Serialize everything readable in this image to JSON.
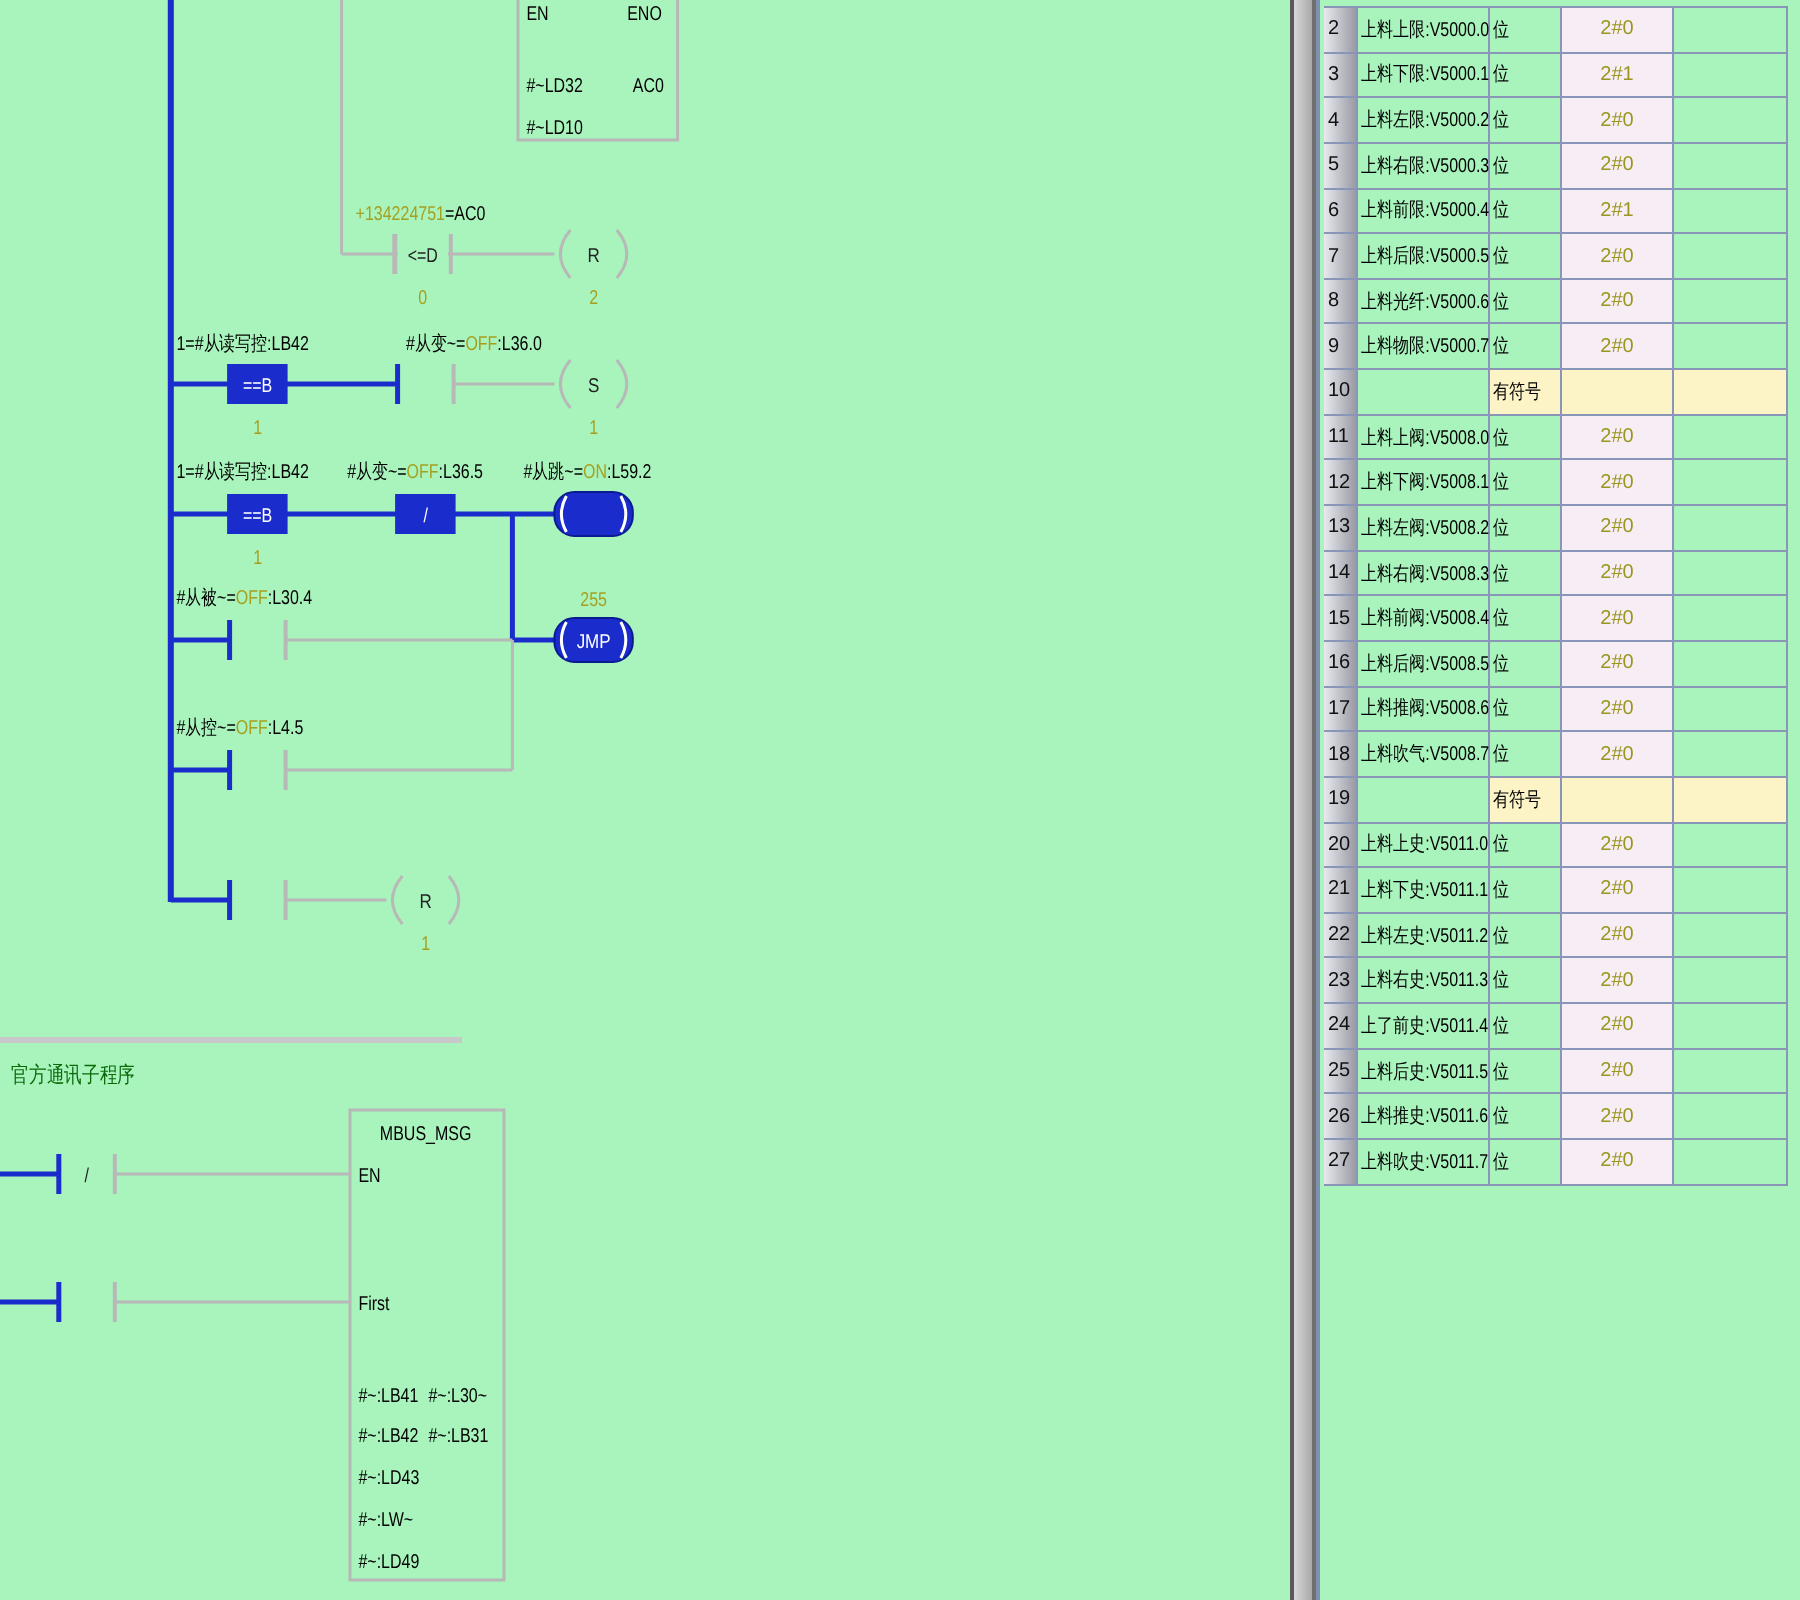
{
  "ladder": {
    "power_flow": true,
    "items": [
      {
        "kind": "box"
      },
      {
        "kind": "label",
        "text": "EN"
      },
      {
        "kind": "label",
        "text": "ENO"
      },
      {
        "kind": "label",
        "text": "#~LD32"
      },
      {
        "kind": "label",
        "text": "AC0"
      },
      {
        "kind": "label",
        "text": "#~LD10"
      },
      {
        "kind": "operand",
        "value": "+134224751",
        "suffix": "=AC0"
      },
      {
        "kind": "compare",
        "text": "<=D",
        "on": false
      },
      {
        "kind": "param",
        "text": "0"
      },
      {
        "kind": "coil",
        "text": "R",
        "on": false
      },
      {
        "kind": "param",
        "text": "2"
      },
      {
        "kind": "label",
        "text": "1=#从读写控:LB42"
      },
      {
        "kind": "operand",
        "prefix": "#从变~=",
        "value": "OFF",
        "suffix": ":L36.0"
      },
      {
        "kind": "compare",
        "text": "==B",
        "on": true
      },
      {
        "kind": "param",
        "text": "1"
      },
      {
        "kind": "contact",
        "on": false,
        "fed": true
      },
      {
        "kind": "coil",
        "text": "S",
        "on": false
      },
      {
        "kind": "param",
        "text": "1"
      },
      {
        "kind": "label",
        "text": "1=#从读写控:LB42"
      },
      {
        "kind": "operand",
        "prefix": "#从变~=",
        "value": "OFF",
        "suffix": ":L36.5"
      },
      {
        "kind": "operand",
        "prefix": "#从跳~=",
        "value": "ON",
        "suffix": ":L59.2"
      },
      {
        "kind": "compare",
        "text": "==B",
        "on": true
      },
      {
        "kind": "param",
        "text": "1"
      },
      {
        "kind": "contact",
        "text": "/",
        "on": true
      },
      {
        "kind": "coil",
        "on": true
      },
      {
        "kind": "operand",
        "prefix": "#从被~=",
        "value": "OFF",
        "suffix": ":L30.4"
      },
      {
        "kind": "param",
        "text": "255"
      },
      {
        "kind": "contact",
        "on": false,
        "fed": true
      },
      {
        "kind": "coil",
        "text": "JMP",
        "on": true
      },
      {
        "kind": "operand",
        "prefix": "#从控~=",
        "value": "OFF",
        "suffix": ":L4.5"
      },
      {
        "kind": "contact",
        "on": false,
        "fed": true
      },
      {
        "kind": "contact",
        "on": false,
        "fed": true
      },
      {
        "kind": "coil",
        "text": "R",
        "on": false
      },
      {
        "kind": "param",
        "text": "1"
      },
      {
        "kind": "title",
        "text": "官方通讯子程序"
      },
      {
        "kind": "box"
      },
      {
        "kind": "label",
        "text": "MBUS_MSG"
      },
      {
        "kind": "contact",
        "text": "/",
        "on": false,
        "fed": true
      },
      {
        "kind": "label",
        "text": "EN"
      },
      {
        "kind": "contact",
        "on": false,
        "fed": true
      },
      {
        "kind": "label",
        "text": "First"
      },
      {
        "kind": "label",
        "text": "#~:LB41"
      },
      {
        "kind": "label",
        "text": "#~:L30~"
      },
      {
        "kind": "label",
        "text": "#~:LB42"
      },
      {
        "kind": "label",
        "text": "#~:LB31"
      },
      {
        "kind": "label",
        "text": "#~:LD43"
      },
      {
        "kind": "label",
        "text": "#~:LW~"
      },
      {
        "kind": "label",
        "text": "#~:LD49"
      }
    ]
  },
  "table": {
    "rows": [
      {
        "index": "2",
        "name": "上料上限:V5000.0",
        "type": "位",
        "value": "2#0",
        "kind": "bit"
      },
      {
        "index": "3",
        "name": "上料下限:V5000.1",
        "type": "位",
        "value": "2#1",
        "kind": "bit"
      },
      {
        "index": "4",
        "name": "上料左限:V5000.2",
        "type": "位",
        "value": "2#0",
        "kind": "bit"
      },
      {
        "index": "5",
        "name": "上料右限:V5000.3",
        "type": "位",
        "value": "2#0",
        "kind": "bit"
      },
      {
        "index": "6",
        "name": "上料前限:V5000.4",
        "type": "位",
        "value": "2#1",
        "kind": "bit"
      },
      {
        "index": "7",
        "name": "上料后限:V5000.5",
        "type": "位",
        "value": "2#0",
        "kind": "bit"
      },
      {
        "index": "8",
        "name": "上料光纤:V5000.6",
        "type": "位",
        "value": "2#0",
        "kind": "bit"
      },
      {
        "index": "9",
        "name": "上料物限:V5000.7",
        "type": "位",
        "value": "2#0",
        "kind": "bit"
      },
      {
        "index": "10",
        "type": "有符号",
        "kind": "blank"
      },
      {
        "index": "11",
        "name": "上料上阀:V5008.0",
        "type": "位",
        "value": "2#0",
        "kind": "bit"
      },
      {
        "index": "12",
        "name": "上料下阀:V5008.1",
        "type": "位",
        "value": "2#0",
        "kind": "bit"
      },
      {
        "index": "13",
        "name": "上料左阀:V5008.2",
        "type": "位",
        "value": "2#0",
        "kind": "bit"
      },
      {
        "index": "14",
        "name": "上料右阀:V5008.3",
        "type": "位",
        "value": "2#0",
        "kind": "bit"
      },
      {
        "index": "15",
        "name": "上料前阀:V5008.4",
        "type": "位",
        "value": "2#0",
        "kind": "bit"
      },
      {
        "index": "16",
        "name": "上料后阀:V5008.5",
        "type": "位",
        "value": "2#0",
        "kind": "bit"
      },
      {
        "index": "17",
        "name": "上料推阀:V5008.6",
        "type": "位",
        "value": "2#0",
        "kind": "bit"
      },
      {
        "index": "18",
        "name": "上料吹气:V5008.7",
        "type": "位",
        "value": "2#0",
        "kind": "bit"
      },
      {
        "index": "19",
        "type": "有符号",
        "kind": "blank"
      },
      {
        "index": "20",
        "name": "上料上史:V5011.0",
        "type": "位",
        "value": "2#0",
        "kind": "bit"
      },
      {
        "index": "21",
        "name": "上料下史:V5011.1",
        "type": "位",
        "value": "2#0",
        "kind": "bit"
      },
      {
        "index": "22",
        "name": "上料左史:V5011.2",
        "type": "位",
        "value": "2#0",
        "kind": "bit"
      },
      {
        "index": "23",
        "name": "上料右史:V5011.3",
        "type": "位",
        "value": "2#0",
        "kind": "bit"
      },
      {
        "index": "24",
        "name": "上了前史:V5011.4",
        "type": "位",
        "value": "2#0",
        "kind": "bit"
      },
      {
        "index": "25",
        "name": "上料后史:V5011.5",
        "type": "位",
        "value": "2#0",
        "kind": "bit"
      },
      {
        "index": "26",
        "name": "上料推史:V5011.6",
        "type": "位",
        "value": "2#0",
        "kind": "bit"
      },
      {
        "index": "27",
        "name": "上料吹史:V5011.7",
        "type": "位",
        "value": "2#0",
        "kind": "bit"
      }
    ]
  }
}
